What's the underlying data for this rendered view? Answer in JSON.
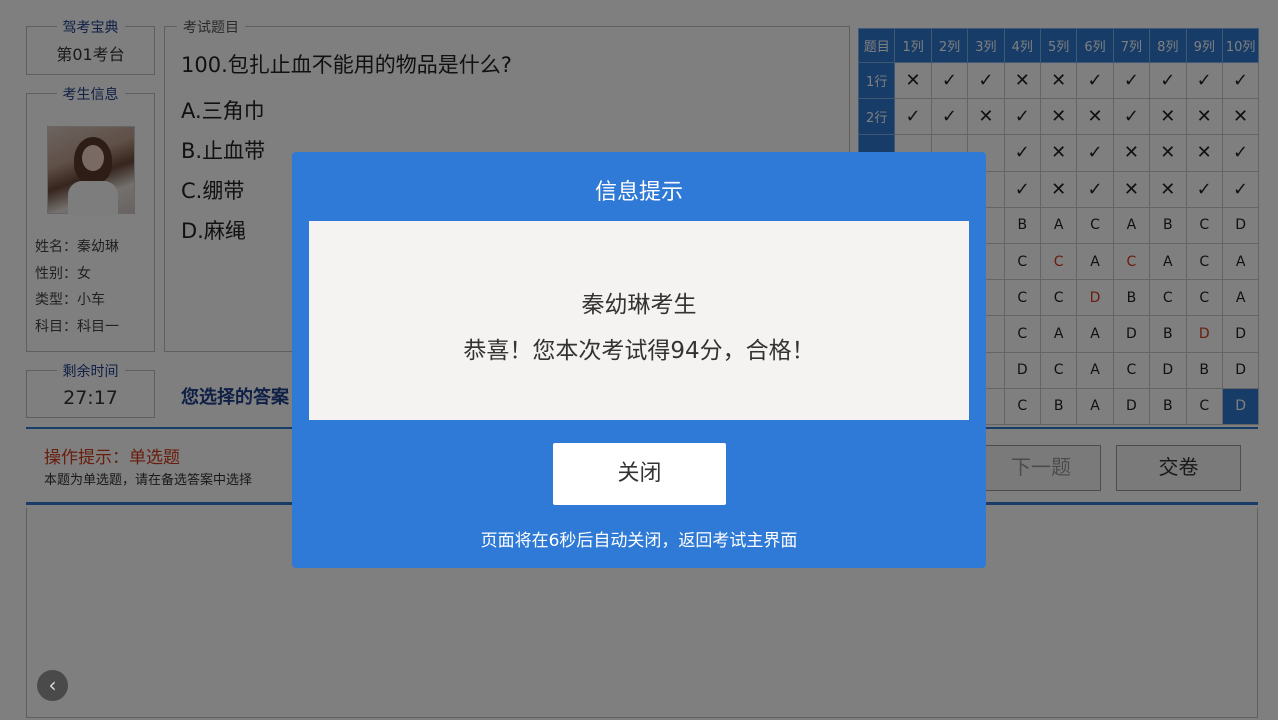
{
  "station": {
    "legend": "驾考宝典",
    "value": "第01考台"
  },
  "examinee": {
    "legend": "考生信息",
    "name": "姓名：秦幼琳",
    "gender": "性别：女",
    "type": "类型：小车",
    "subject": "科目：科目一"
  },
  "timer": {
    "legend": "剩余时间",
    "value": "27:17"
  },
  "question": {
    "legend": "考试题目",
    "text": "100.包扎止血不能用的物品是什么?",
    "options": [
      "A.三角巾",
      "B.止血带",
      "C.绷带",
      "D.麻绳"
    ]
  },
  "answer_label": "您选择的答案",
  "grid": {
    "corner": "题目",
    "columns": [
      "1列",
      "2列",
      "3列",
      "4列",
      "5列",
      "6列",
      "7列",
      "8列",
      "9列",
      "10列"
    ],
    "rows": [
      {
        "label": "1行",
        "cells": [
          "✕",
          "✓",
          "✓",
          "✕",
          "✕",
          "✓",
          "✓",
          "✓",
          "✓",
          "✓"
        ]
      },
      {
        "label": "2行",
        "cells": [
          "✓",
          "✓",
          "✕",
          "✓",
          "✕",
          "✕",
          "✓",
          "✕",
          "✕",
          "✕"
        ]
      },
      {
        "label": "",
        "cells": [
          "",
          "",
          "",
          "✓",
          "✕",
          "✓",
          "✕",
          "✕",
          "✕",
          "✓"
        ]
      },
      {
        "label": "",
        "cells": [
          "",
          "",
          "",
          "✓",
          "✕",
          "✓",
          "✕",
          "✕",
          "✓",
          "✓"
        ]
      },
      {
        "label": "",
        "cells": [
          "",
          "",
          "",
          "B",
          "A",
          "C",
          "A",
          "B",
          "C",
          "D"
        ]
      },
      {
        "label": "",
        "cells": [
          "",
          "",
          "",
          "C",
          "C",
          "A",
          "C",
          "A",
          "C",
          "A"
        ]
      },
      {
        "label": "",
        "cells": [
          "",
          "",
          "",
          "C",
          "C",
          "D",
          "B",
          "C",
          "C",
          "A"
        ]
      },
      {
        "label": "",
        "cells": [
          "",
          "",
          "",
          "C",
          "A",
          "A",
          "D",
          "B",
          "D",
          "D"
        ]
      },
      {
        "label": "",
        "cells": [
          "",
          "",
          "",
          "D",
          "C",
          "A",
          "C",
          "D",
          "B",
          "D"
        ]
      },
      {
        "label": "",
        "cells": [
          "",
          "",
          "",
          "C",
          "B",
          "A",
          "D",
          "B",
          "C",
          "D"
        ]
      }
    ],
    "red_cells": [
      "5-4",
      "5-6",
      "6-5",
      "7-8"
    ],
    "current_cell": "9-9",
    "accent_color": "#2e78d0"
  },
  "tips": {
    "title": "操作提示：单选题",
    "text": "本题为单选题，请在备选答案中选择"
  },
  "buttons": {
    "next": "下一题",
    "submit": "交卷"
  },
  "modal": {
    "title": "信息提示",
    "name_line": "秦幼琳考生",
    "result_line": "恭喜！您本次考试得94分，合格！",
    "close": "关闭",
    "footer": "页面将在6秒后自动关闭，返回考试主界面",
    "color": "#2f7ad6"
  },
  "icons": {
    "back": "chevron-left-icon"
  }
}
